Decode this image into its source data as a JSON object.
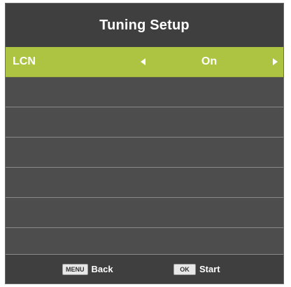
{
  "header": {
    "title": "Tuning Setup"
  },
  "menu": {
    "items": [
      {
        "label": "LCN",
        "value": "On",
        "selected": true
      }
    ],
    "empty_rows": 6
  },
  "footer": {
    "back": {
      "key": "MENU",
      "label": "Back"
    },
    "start": {
      "key": "OK",
      "label": "Start"
    }
  },
  "colors": {
    "panel": "#4d4d4d",
    "title_bar": "#3f3f3f",
    "highlight": "#adc442",
    "divider": "#8a8a8a",
    "text": "#ffffff"
  },
  "icons": {
    "left": "left-arrow-icon",
    "right": "right-arrow-icon"
  }
}
